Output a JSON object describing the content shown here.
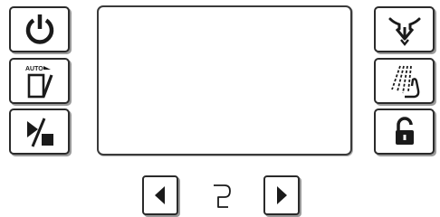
{
  "controls": {
    "left": [
      {
        "icon": "power-icon"
      },
      {
        "icon": "auto-door-icon",
        "icon_text": "AUTO"
      },
      {
        "icon": "start-stop-icon"
      }
    ],
    "right": [
      {
        "icon": "steam-drain-icon"
      },
      {
        "icon": "hand-shower-icon"
      },
      {
        "icon": "unlock-icon"
      }
    ]
  },
  "navigation": {
    "prev_icon": "triangle-left-icon",
    "next_icon": "triangle-right-icon",
    "program_icon": "program-p-icon"
  },
  "colors": {
    "border": "#2a2a2a",
    "shadow": "#9a9a9a",
    "icon": "#1a1a1a",
    "background": "#ffffff"
  }
}
